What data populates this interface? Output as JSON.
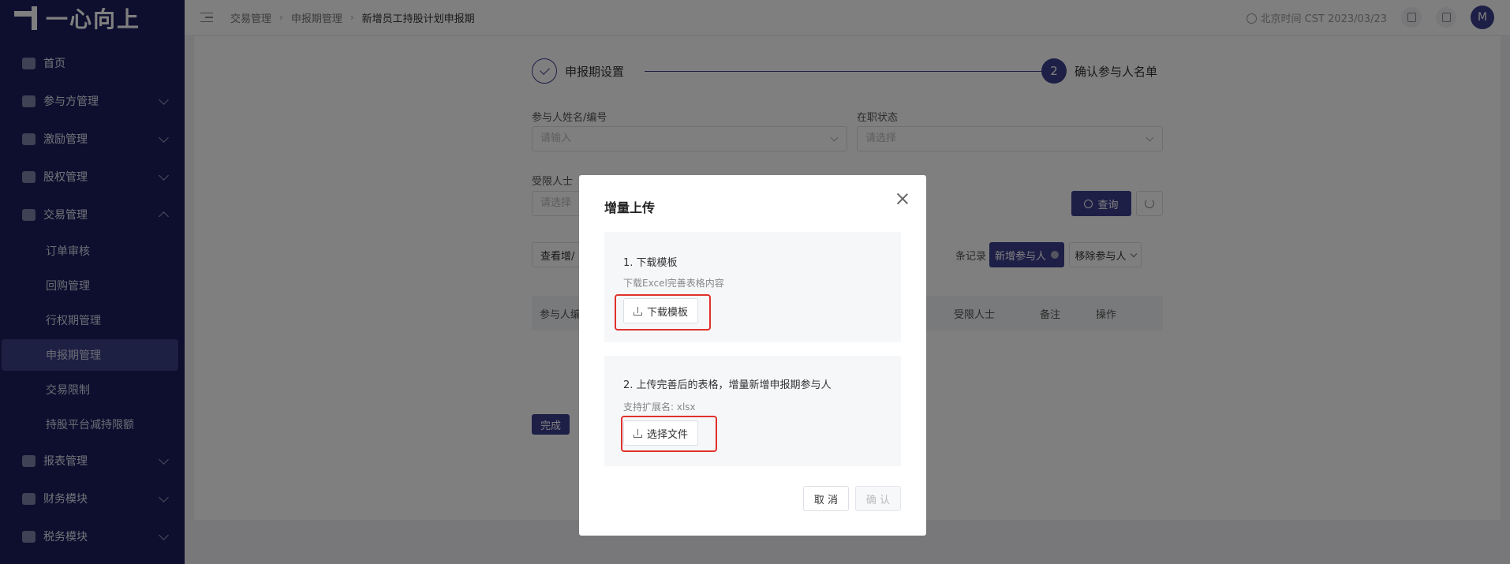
{
  "sidebar": {
    "brand": "一心向上",
    "menu": [
      {
        "label": "首页",
        "icon": "home-icon"
      },
      {
        "label": "参与方管理",
        "icon": "participant-icon"
      },
      {
        "label": "激励管理",
        "icon": "incentive-icon"
      },
      {
        "label": "股权管理",
        "icon": "equity-icon"
      },
      {
        "label": "交易管理",
        "icon": "trade-icon"
      }
    ],
    "trade_sub": [
      "订单审核",
      "回购管理",
      "行权期管理",
      "申报期管理",
      "交易限制",
      "持股平台减持限额"
    ],
    "menu_after": [
      {
        "label": "报表管理",
        "icon": "report-icon"
      },
      {
        "label": "财务模块",
        "icon": "finance-icon"
      },
      {
        "label": "税务模块",
        "icon": "tax-icon"
      }
    ]
  },
  "header": {
    "breadcrumb": [
      "交易管理",
      "申报期管理",
      "新增员工持股计划申报期"
    ],
    "time": "北京时间 CST 2023/03/23",
    "avatar": "M"
  },
  "steps": [
    {
      "index": "1",
      "label": "申报期设置",
      "status": "done"
    },
    {
      "index": "2",
      "label": "确认参与人名单",
      "status": "current"
    }
  ],
  "filters": {
    "name_label": "参与人姓名/编号",
    "name_placeholder": "请输入",
    "status_label": "在职状态",
    "status_placeholder": "请选择",
    "restricted_label": "受限人士",
    "restricted_placeholder": "请选择",
    "query": "查询"
  },
  "toolbar": {
    "view_label": "查看增/",
    "records_suffix": "条记录",
    "add_participant": "新增参与人",
    "remove_participant": "移除参与人"
  },
  "table": {
    "headers": [
      "参与人编",
      "受限人士",
      "备注",
      "操作"
    ]
  },
  "finish": "完成",
  "modal": {
    "title": "增量上传",
    "step1_title": "1. 下载模板",
    "step1_hint": "下载Excel完善表格内容",
    "step1_button": "下载模板",
    "step2_title": "2. 上传完善后的表格，增量新增申报期参与人",
    "step2_hint": "支持扩展名: xlsx",
    "step2_button": "选择文件",
    "cancel": "取 消",
    "confirm": "确 认"
  },
  "colors": {
    "primary": "#3c3f8f",
    "sidebar": "#1c1f5e",
    "highlight": "#e0322c"
  }
}
